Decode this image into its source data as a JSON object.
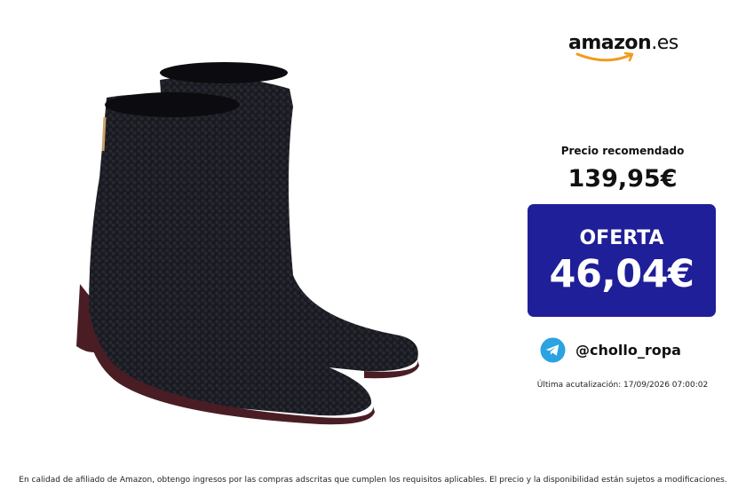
{
  "brand": {
    "logo_main": "amazon",
    "logo_tld": ".es",
    "logo_name": "amazon-logo"
  },
  "product": {
    "image_icon": "ankle-boots-image"
  },
  "pricing": {
    "recommended_label": "Precio recomendado",
    "recommended_price": "139,95€",
    "offer_label": "OFERTA",
    "offer_price": "46,04€",
    "offer_color": "#1f1f9a"
  },
  "channel": {
    "icon": "telegram-icon",
    "handle": "@chollo_ropa",
    "icon_color": "#2aa3e0"
  },
  "updated": "Última acutalización: 17/09/2026 07:00:02",
  "disclaimer": "En calidad de afiliado de Amazon, obtengo ingresos por las compras adscritas que cumplen los requisitos aplicables. El precio y la disponibilidad están sujetos a modificaciones."
}
